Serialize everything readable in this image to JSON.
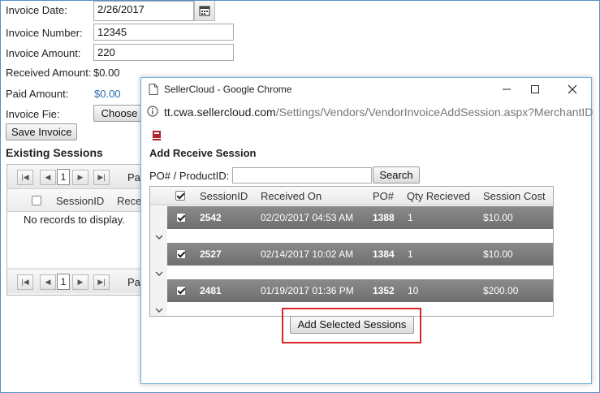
{
  "form": {
    "invoice_date_label": "Invoice Date:",
    "invoice_date_value": "2/26/2017",
    "invoice_number_label": "Invoice Number:",
    "invoice_number_value": "12345",
    "invoice_amount_label": "Invoice Amount:",
    "invoice_amount_value": "220",
    "received_amount_label": "Received Amount:",
    "received_amount_value": "$0.00",
    "paid_amount_label": "Paid Amount:",
    "paid_amount_value": "$0.00",
    "invoice_file_label": "Invoice Fie:",
    "choose_label": "Choose",
    "save_invoice_label": "Save Invoice"
  },
  "existing_sessions": {
    "title": "Existing Sessions",
    "page": "1",
    "page_label_truncated": "Pa",
    "col_session_id": "SessionID",
    "col_received_truncated": "Recei",
    "empty_text": "No records to display."
  },
  "popup": {
    "window_title": "SellerCloud - Google Chrome",
    "url_host": "tt.cwa.sellercloud.com",
    "url_path": "/Settings/Vendors/VendorInvoiceAddSession.aspx?MerchantID",
    "heading": "Add Receive Session",
    "search_label": "PO# / ProductID:",
    "search_value": "",
    "search_button": "Search",
    "columns": [
      "SessionID",
      "Received On",
      "PO#",
      "Qty Recieved",
      "Session Cost"
    ],
    "rows": [
      {
        "session_id": "2542",
        "received_on": "02/20/2017 04:53 AM",
        "po": "1388",
        "qty": "1",
        "cost": "$10.00",
        "checked": true
      },
      {
        "session_id": "2527",
        "received_on": "02/14/2017 10:02 AM",
        "po": "1384",
        "qty": "1",
        "cost": "$10.00",
        "checked": true
      },
      {
        "session_id": "2481",
        "received_on": "01/19/2017 01:36 PM",
        "po": "1352",
        "qty": "10",
        "cost": "$200.00",
        "checked": true
      }
    ],
    "add_button": "Add Selected Sessions"
  },
  "colors": {
    "row_bar": "#7d7d7d",
    "highlight": "#d9262b",
    "link_blue": "#2a6db0",
    "window_border": "#6fb0d8"
  }
}
